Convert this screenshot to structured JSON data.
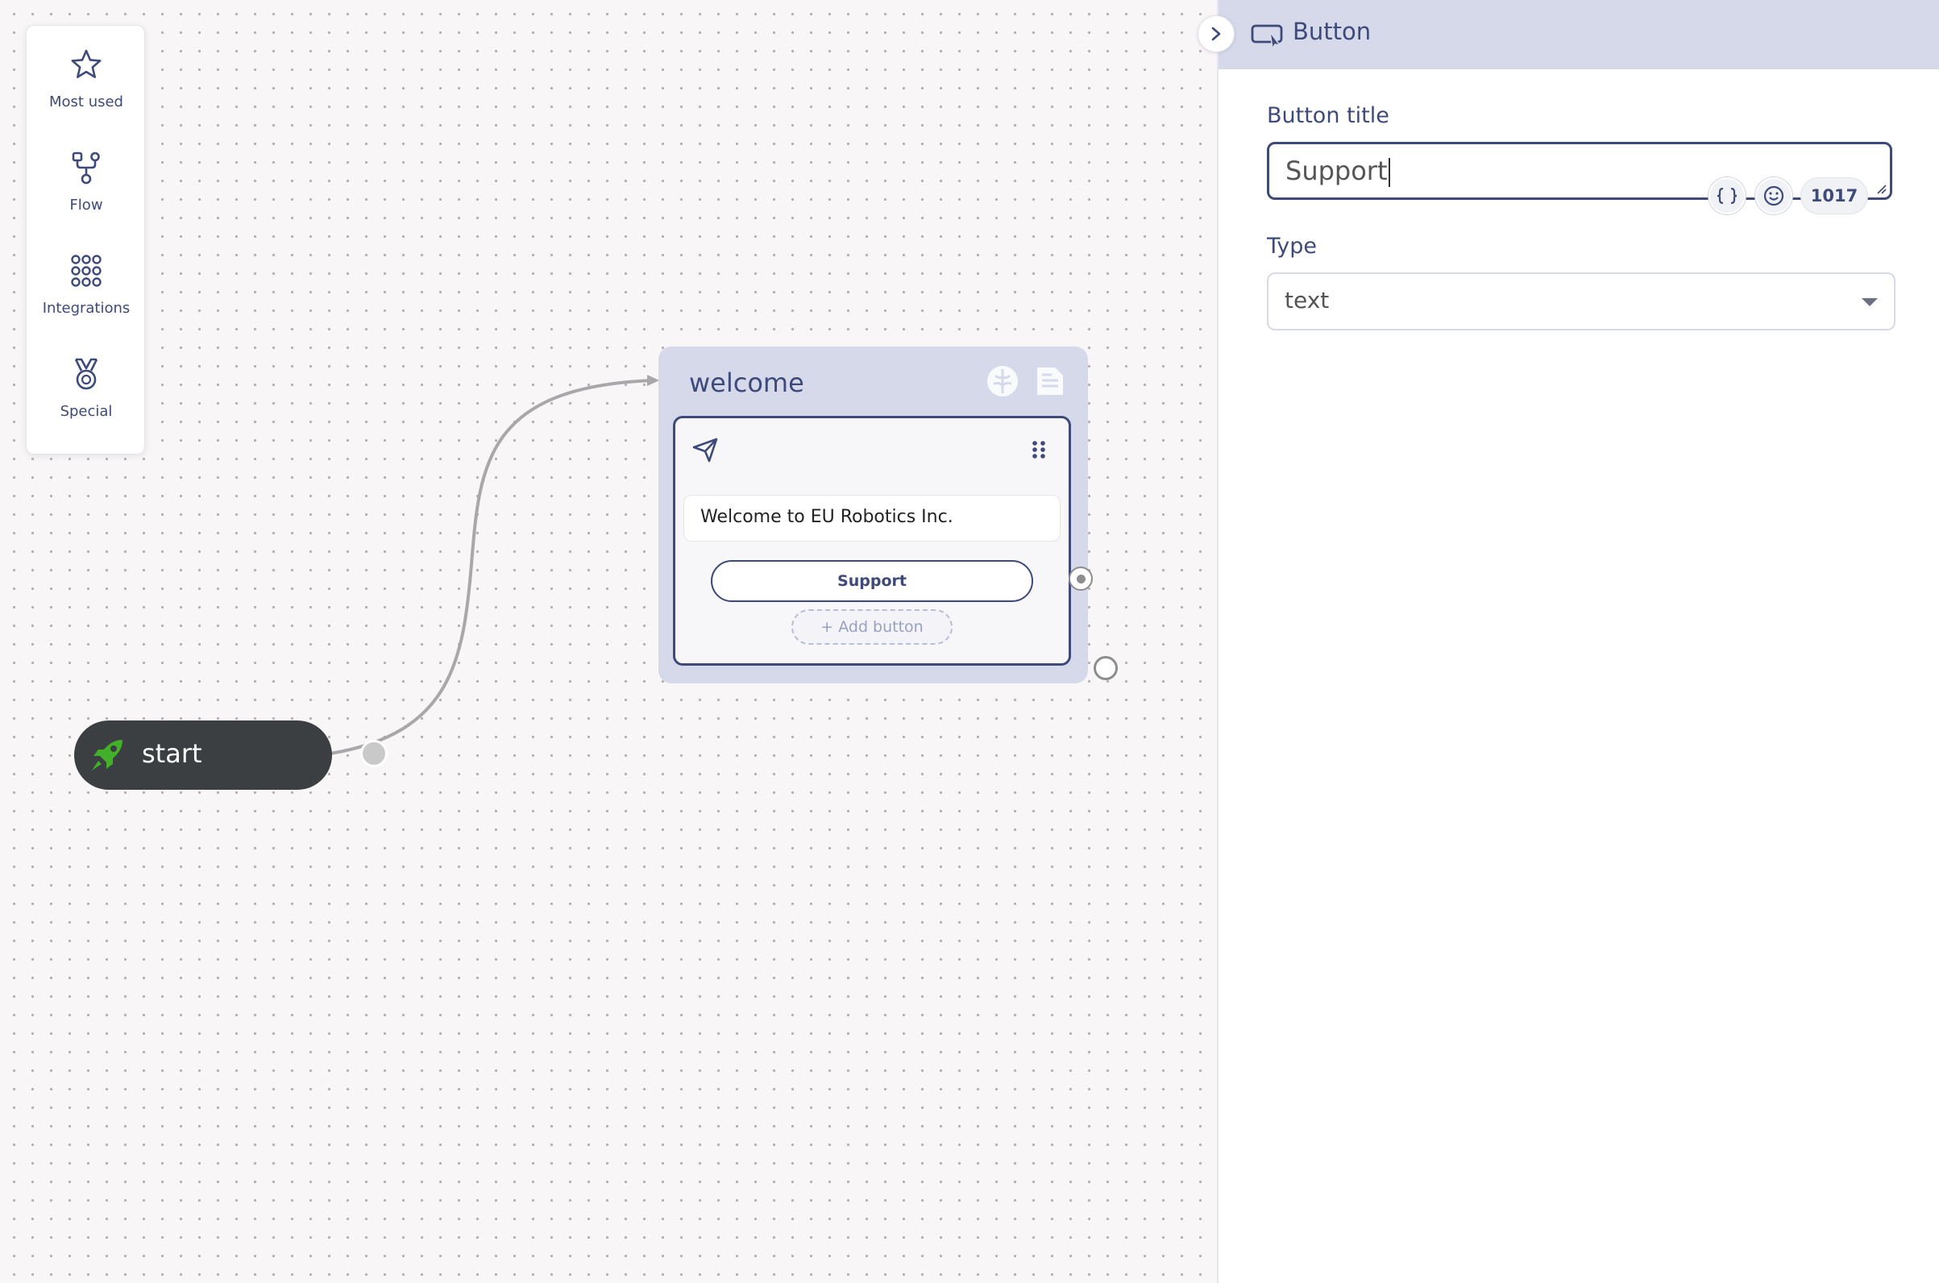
{
  "palette": {
    "items": [
      {
        "label": "Most used",
        "icon": "star-icon"
      },
      {
        "label": "Flow",
        "icon": "flow-icon"
      },
      {
        "label": "Integrations",
        "icon": "grid-icon"
      },
      {
        "label": "Special",
        "icon": "medal-icon"
      }
    ]
  },
  "start_node": {
    "label": "start"
  },
  "block": {
    "title": "welcome",
    "message": "Welcome to EU Robotics Inc.",
    "button_label": "Support",
    "add_button_label": "+ Add button"
  },
  "panel": {
    "title": "Button",
    "button_title_label": "Button title",
    "button_title_value": "Support",
    "char_count": "1017",
    "type_label": "Type",
    "type_value": "text"
  },
  "colors": {
    "accent": "#3d4a7a",
    "block_bg": "#d6d9ea",
    "start_bg": "#3b3f41",
    "rocket_green": "#43b02a"
  }
}
